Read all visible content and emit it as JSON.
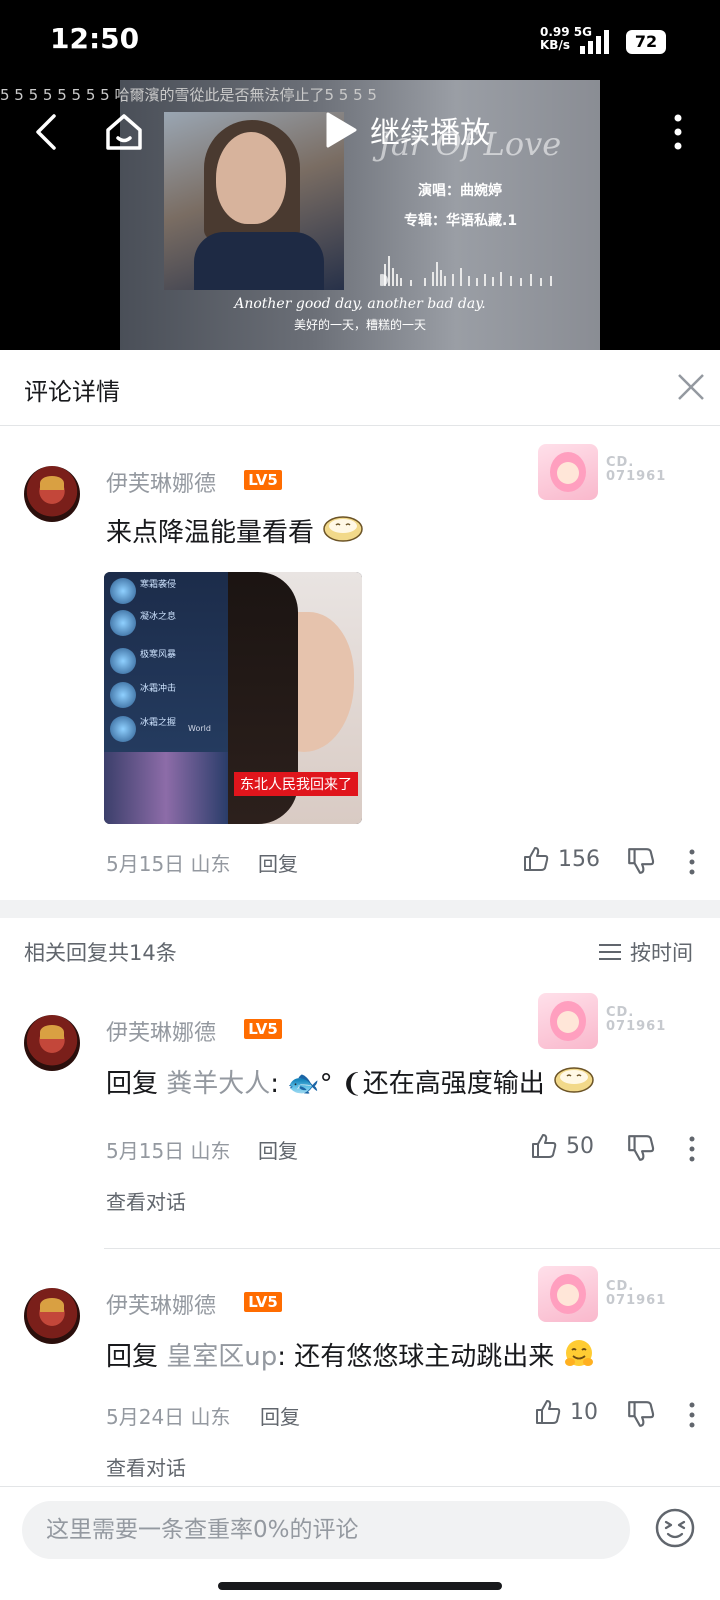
{
  "status_bar": {
    "time": "12:50",
    "speed_value": "0.99",
    "speed_unit": "KB/s",
    "network": "5G",
    "battery": "72"
  },
  "player": {
    "danmaku": "5    5    5    5    5    5    5    5    哈爾濱的雪從此是否無法停止了5    5    5    5",
    "continue_label": "继续播放",
    "song_title": "Jar Of Love",
    "singer": "演唱：曲婉婷",
    "album": "专辑：华语私藏.1",
    "lyric_en": "Another good day, another bad day.",
    "lyric_cn": "美好的一天，糟糕的一天"
  },
  "panel": {
    "title": "评论详情"
  },
  "main_comment": {
    "username": "伊芙琳娜德",
    "level": "LV5",
    "badge_code_1": "CD.",
    "badge_code_2": "071961",
    "text": "来点降温能量看看",
    "image_caption": "东北人民我回来了",
    "image_skills": [
      "寒霜袭侵",
      "凝冰之息",
      "极寒风暴",
      "冰霜冲击",
      "冰霜之握"
    ],
    "image_world": "World",
    "date": "5月15日",
    "location": "山东",
    "reply_label": "回复",
    "likes": "156"
  },
  "replies_header": {
    "count_label": "相关回复共14条",
    "sort_label": "按时间"
  },
  "replies": [
    {
      "username": "伊芙琳娜德",
      "level": "LV5",
      "badge_code_1": "CD.",
      "badge_code_2": "071961",
      "reply_prefix": "回复 ",
      "reply_to": "粪羊大人",
      "text": ": 🐟° ❨还在高强度输出",
      "date": "5月15日",
      "location": "山东",
      "reply_label": "回复",
      "likes": "50",
      "view_conversation": "查看对话"
    },
    {
      "username": "伊芙琳娜德",
      "level": "LV5",
      "badge_code_1": "CD.",
      "badge_code_2": "071961",
      "reply_prefix": "回复 ",
      "reply_to": "皇室区up",
      "text": ": 还有悠悠球主动跳出来",
      "date": "5月24日",
      "location": "山东",
      "reply_label": "回复",
      "likes": "10",
      "view_conversation": "查看对话"
    }
  ],
  "composer": {
    "placeholder": "这里需要一条查重率0%的评论"
  },
  "colors": {
    "accent_level": "#ff6c00",
    "text_primary": "#18191c",
    "text_secondary": "#9499a0"
  }
}
